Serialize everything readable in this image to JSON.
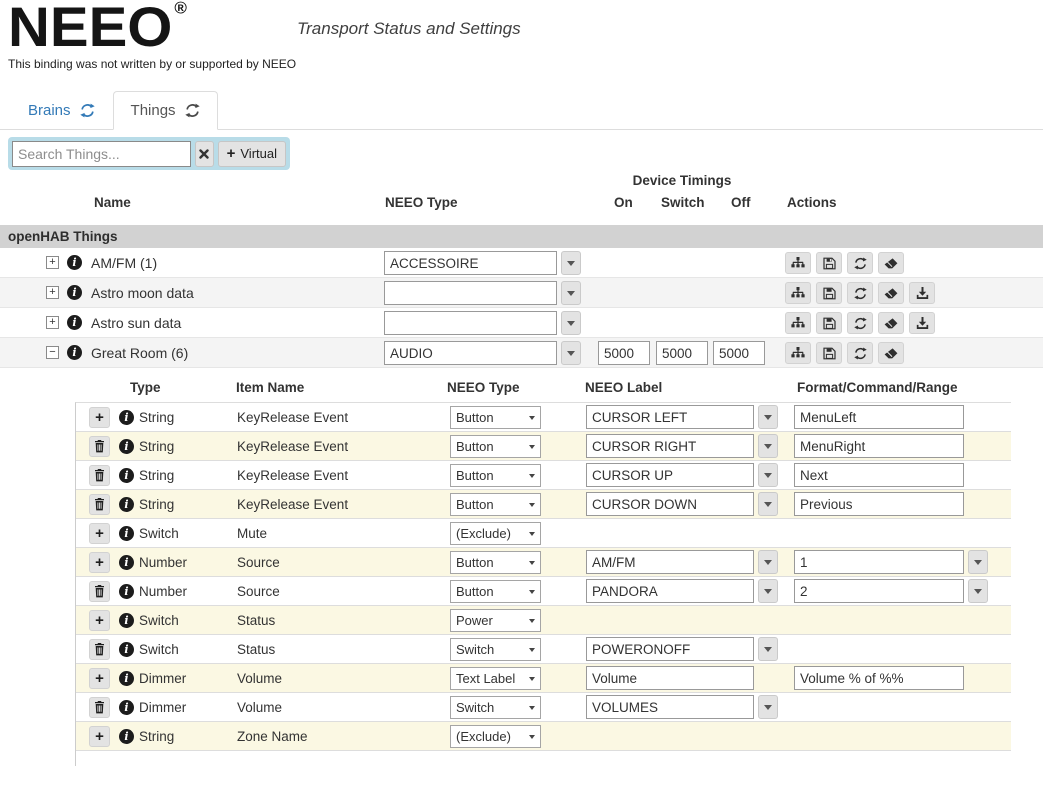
{
  "header": {
    "logo": "NEEO",
    "registered": "®",
    "title": "Transport Status and Settings",
    "disclaimer": "This binding was not written by or supported by NEEO"
  },
  "tabs": {
    "brains": {
      "label": "Brains"
    },
    "things": {
      "label": "Things"
    }
  },
  "search": {
    "placeholder": "Search Things...",
    "virtual_label": "Virtual"
  },
  "icons": {
    "expand_glyph": "+",
    "collapse_glyph": "−",
    "plus_glyph": "+",
    "info_glyph": "i"
  },
  "colors": {
    "tab_accent": "#337ab7",
    "search_panel": "#b8dce8",
    "row_highlight": "#fbf8e3",
    "section_bar": "#d2d2d2"
  },
  "main_table": {
    "group_header": "Device Timings",
    "columns": {
      "name": "Name",
      "neeo_type": "NEEO Type",
      "on": "On",
      "switch": "Switch",
      "off": "Off",
      "actions": "Actions"
    },
    "section_label": "openHAB Things",
    "rows": [
      {
        "name": "AM/FM (1)",
        "neeo_type": "ACCESSOIRE"
      },
      {
        "name": "Astro moon data",
        "neeo_type": ""
      },
      {
        "name": "Astro sun data",
        "neeo_type": ""
      },
      {
        "name": "Great Room (6)",
        "neeo_type": "AUDIO",
        "on": "5000",
        "switch": "5000",
        "off": "5000"
      }
    ]
  },
  "channels_table": {
    "columns": {
      "type": "Type",
      "item_name": "Item Name",
      "neeo_type": "NEEO Type",
      "neeo_label": "NEEO Label",
      "format": "Format/Command/Range"
    },
    "rows": [
      {
        "type": "String",
        "item": "KeyRelease Event",
        "neeo_type": "Button",
        "label": "CURSOR LEFT",
        "format": "MenuLeft"
      },
      {
        "type": "String",
        "item": "KeyRelease Event",
        "neeo_type": "Button",
        "label": "CURSOR RIGHT",
        "format": "MenuRight"
      },
      {
        "type": "String",
        "item": "KeyRelease Event",
        "neeo_type": "Button",
        "label": "CURSOR UP",
        "format": "Next"
      },
      {
        "type": "String",
        "item": "KeyRelease Event",
        "neeo_type": "Button",
        "label": "CURSOR DOWN",
        "format": "Previous"
      },
      {
        "type": "Switch",
        "item": "Mute",
        "neeo_type": "(Exclude)"
      },
      {
        "type": "Number",
        "item": "Source",
        "neeo_type": "Button",
        "label": "AM/FM",
        "format": "1"
      },
      {
        "type": "Number",
        "item": "Source",
        "neeo_type": "Button",
        "label": "PANDORA",
        "format": "2"
      },
      {
        "type": "Switch",
        "item": "Status",
        "neeo_type": "Power"
      },
      {
        "type": "Switch",
        "item": "Status",
        "neeo_type": "Switch",
        "label": "POWERONOFF"
      },
      {
        "type": "Dimmer",
        "item": "Volume",
        "neeo_type": "Text Label",
        "label": "Volume",
        "format": "Volume % of %%"
      },
      {
        "type": "Dimmer",
        "item": "Volume",
        "neeo_type": "Switch",
        "label": "VOLUMES"
      },
      {
        "type": "String",
        "item": "Zone Name",
        "neeo_type": "(Exclude)"
      }
    ]
  }
}
